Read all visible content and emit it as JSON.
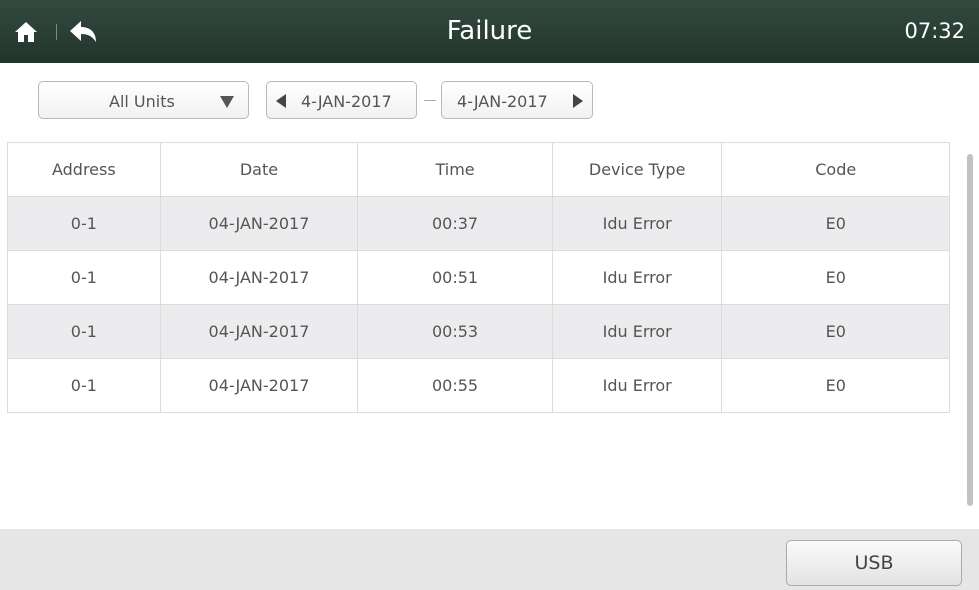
{
  "header": {
    "title": "Failure",
    "clock": "07:32"
  },
  "filter": {
    "unit_select": "All Units",
    "date_from": "4-JAN-2017",
    "date_to": "4-JAN-2017"
  },
  "table": {
    "columns": [
      "Address",
      "Date",
      "Time",
      "Device Type",
      "Code"
    ],
    "rows": [
      [
        "0-1",
        "04-JAN-2017",
        "00:37",
        "Idu Error",
        "E0"
      ],
      [
        "0-1",
        "04-JAN-2017",
        "00:51",
        "Idu Error",
        "E0"
      ],
      [
        "0-1",
        "04-JAN-2017",
        "00:53",
        "Idu Error",
        "E0"
      ],
      [
        "0-1",
        "04-JAN-2017",
        "00:55",
        "Idu Error",
        "E0"
      ]
    ]
  },
  "footer": {
    "usb_label": "USB"
  },
  "icons": {
    "home": "home-icon",
    "back": "back-arrow-icon",
    "dropdown": "caret-down-icon",
    "prev": "arrow-left-icon",
    "next": "arrow-right-icon"
  },
  "colors": {
    "header_bg": "#2a3e34",
    "row_stripe": "#ececee",
    "footer_bg": "#e6e6e6"
  }
}
